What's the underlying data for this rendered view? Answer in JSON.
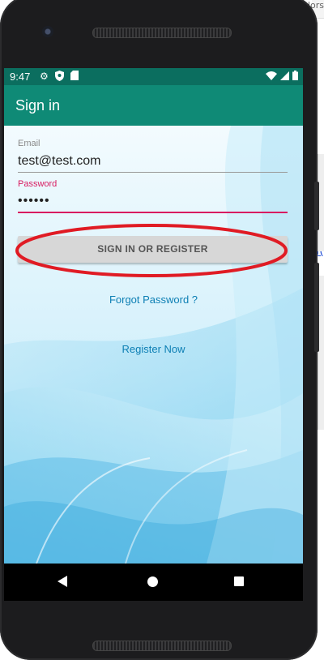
{
  "background": {
    "top_text": "olors",
    "partial_link": "n("
  },
  "status_bar": {
    "time": "9:47",
    "icons_left": [
      "gear-icon",
      "shield-icon",
      "sd-card-icon"
    ],
    "icons_right": [
      "wifi-icon",
      "signal-icon",
      "battery-icon"
    ],
    "color": "#0b6e5f"
  },
  "app_bar": {
    "title": "Sign in",
    "color": "#0f8a76"
  },
  "form": {
    "email_label": "Email",
    "email_value": "test@test.com",
    "password_label": "Password",
    "password_value": "••••••",
    "accent_color": "#d81b60"
  },
  "actions": {
    "signin_label": "SIGN IN OR REGISTER",
    "forgot_label": "Forgot Password ?",
    "register_label": "Register Now",
    "link_color": "#0d7fb4"
  },
  "annotation": {
    "highlight_color": "#e01b24"
  },
  "nav_bar": {
    "icons": [
      "back-icon",
      "home-icon",
      "recent-apps-icon"
    ]
  }
}
